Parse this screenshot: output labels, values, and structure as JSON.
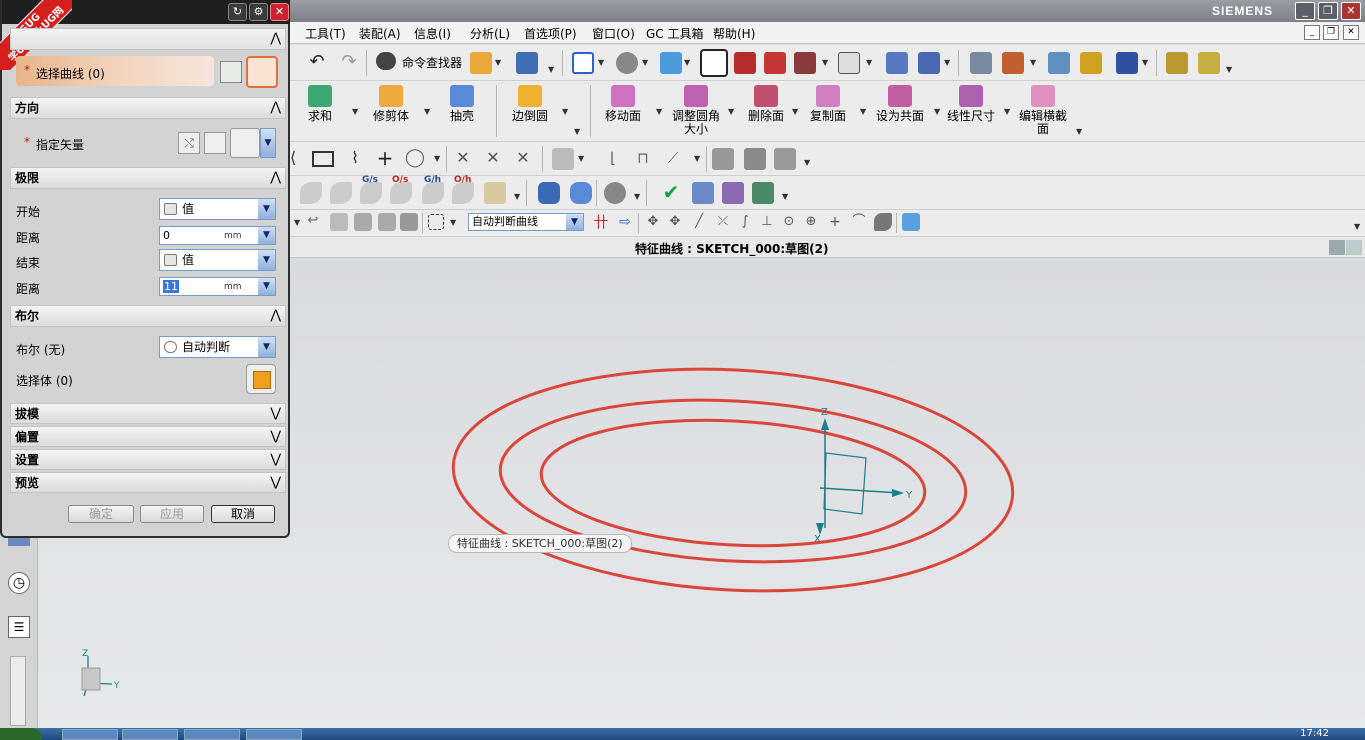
{
  "window": {
    "brand": "SIEMENS",
    "min": "_",
    "max": "❐",
    "close": "✕",
    "mdi_min": "_",
    "mdi_max": "❐",
    "mdi_close": "✕"
  },
  "menu": {
    "items": [
      "工具(T)",
      "装配(A)",
      "信息(I)",
      "分析(L)",
      "首选项(P)",
      "窗口(O)",
      "GC 工具箱",
      "帮助(H)"
    ]
  },
  "toolbar": {
    "command_finder": "命令查找器",
    "features": [
      "求和",
      "修剪体",
      "抽壳",
      "边倒圆",
      "移动面",
      "调整圆角大小",
      "删除面",
      "复制面",
      "设为共面",
      "线性尺寸",
      "编辑横截面"
    ],
    "curve_rule": "自动判断曲线",
    "sketch_labels": [
      "G/s",
      "O/s",
      "G/h",
      "O/h"
    ]
  },
  "status": {
    "text": "特征曲线 : SKETCH_000:草图(2)"
  },
  "tooltip": {
    "text": "特征曲线 : SKETCH_000:草图(2)"
  },
  "axes": {
    "z": "Z",
    "y": "Y",
    "x": "X"
  },
  "colors": {
    "curve": "#d9473a",
    "csys": "#1b7f86"
  },
  "dialog": {
    "watermark_line1": "9SUG",
    "watermark_line2": "学UG就上UG网",
    "select_curve": {
      "label": "选择曲线 (0)",
      "required": "*"
    },
    "direction": {
      "title": "方向",
      "vector_label": "指定矢量",
      "required": "*"
    },
    "limits": {
      "title": "极限",
      "start_label": "开始",
      "start_value": "值",
      "start_dist_label": "距离",
      "start_dist_value": "0",
      "end_label": "结束",
      "end_value": "值",
      "end_dist_label": "距离",
      "end_dist_value": "11",
      "unit": "mm"
    },
    "boolean": {
      "title": "布尔",
      "label": "布尔 (无)",
      "value": "自动判断",
      "body_label": "选择体 (0)"
    },
    "collapsed": [
      "拔模",
      "偏置",
      "设置",
      "预览"
    ],
    "buttons": {
      "ok": "确定",
      "apply": "应用",
      "cancel": "取消"
    },
    "chev_up": "⋀",
    "chev_down": "⋁"
  },
  "clock": "17:42"
}
